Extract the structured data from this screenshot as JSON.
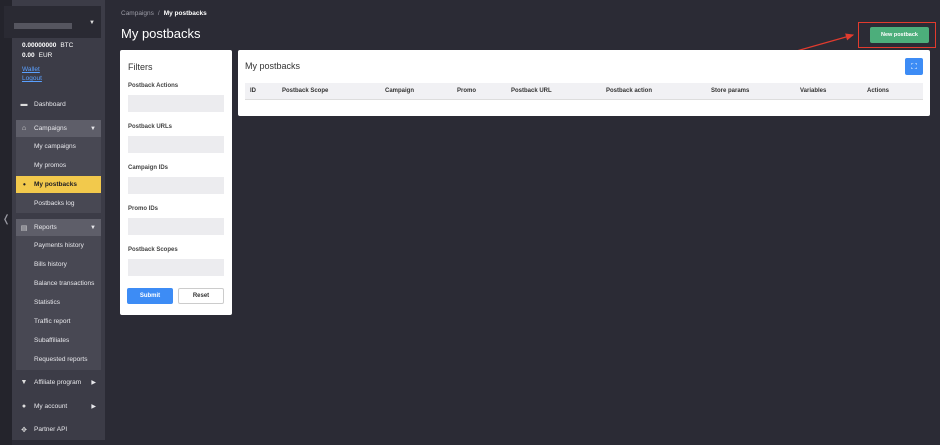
{
  "account": {
    "balances": [
      {
        "amount": "0.00000000",
        "currency": "BTC"
      },
      {
        "amount": "0.00",
        "currency": "EUR"
      }
    ],
    "links": [
      "Wallet",
      "Logout"
    ]
  },
  "sidebar": {
    "dashboard": "Dashboard",
    "campaigns": {
      "label": "Campaigns",
      "items": [
        "My campaigns",
        "My promos",
        "My postbacks",
        "Postbacks log"
      ]
    },
    "reports": {
      "label": "Reports",
      "items": [
        "Payments history",
        "Bills history",
        "Balance transactions",
        "Statistics",
        "Traffic report",
        "Subaffiliates",
        "Requested reports"
      ]
    },
    "affiliate": "Affiliate program",
    "account": "My account",
    "partner_api": "Partner API"
  },
  "breadcrumb": {
    "parent": "Campaigns",
    "separator": "/",
    "current": "My postbacks"
  },
  "page_title": "My postbacks",
  "new_button": "New postback",
  "filters": {
    "title": "Filters",
    "fields": [
      "Postback Actions",
      "Postback URLs",
      "Campaign IDs",
      "Promo IDs",
      "Postback Scopes"
    ],
    "submit": "Submit",
    "reset": "Reset"
  },
  "table": {
    "title": "My postbacks",
    "columns": [
      "ID",
      "Postback Scope",
      "Campaign",
      "Promo",
      "Postback URL",
      "Postback action",
      "Store params",
      "Variables",
      "Actions"
    ]
  },
  "colors": {
    "accent_green": "#4cae7b",
    "accent_blue": "#3d8cf5",
    "active_yellow": "#f2c94c",
    "annotation_red": "#e23b2e"
  }
}
